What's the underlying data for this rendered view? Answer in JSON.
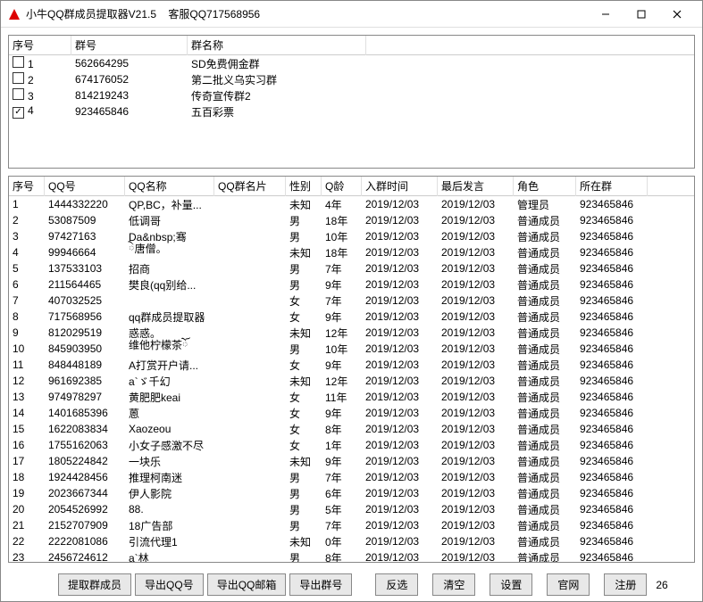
{
  "title": "小牛QQ群成员提取器V21.5    客服QQ717568956",
  "topGrid": {
    "headers": [
      "序号",
      "群号",
      "群名称"
    ],
    "rows": [
      {
        "checked": false,
        "idx": "1",
        "gid": "562664295",
        "gname": "SD免费佣金群"
      },
      {
        "checked": false,
        "idx": "2",
        "gid": "674176052",
        "gname": "第二批义乌实习群"
      },
      {
        "checked": false,
        "idx": "3",
        "gid": "814219243",
        "gname": "传奇宣传群2"
      },
      {
        "checked": true,
        "idx": "4",
        "gid": "923465846",
        "gname": "五百彩票"
      }
    ]
  },
  "bottomGrid": {
    "headers": [
      "序号",
      "QQ号",
      "QQ名称",
      "QQ群名片",
      "性别",
      "Q龄",
      "入群时间",
      "最后发言",
      "角色",
      "所在群"
    ],
    "rows": [
      {
        "c": [
          "1",
          "1444332220",
          "QP,BC，补量...",
          "",
          "未知",
          "4年",
          "2019/12/03",
          "2019/12/03",
          "管理员",
          "923465846"
        ]
      },
      {
        "c": [
          "2",
          "53087509",
          "低调哥",
          "",
          "男",
          "18年",
          "2019/12/03",
          "2019/12/03",
          "普通成员",
          "923465846"
        ]
      },
      {
        "c": [
          "3",
          "97427163",
          "Da&nbsp;骞",
          "",
          "男",
          "10年",
          "2019/12/03",
          "2019/12/03",
          "普通成员",
          "923465846"
        ]
      },
      {
        "c": [
          "4",
          "99946664",
          "ེ唐僧。",
          "",
          "未知",
          "18年",
          "2019/12/03",
          "2019/12/03",
          "普通成员",
          "923465846"
        ]
      },
      {
        "c": [
          "5",
          "137533103",
          "招商",
          "",
          "男",
          "7年",
          "2019/12/03",
          "2019/12/03",
          "普通成员",
          "923465846"
        ]
      },
      {
        "c": [
          "6",
          "211564465",
          "樊良(qq别给...",
          "",
          "男",
          "9年",
          "2019/12/03",
          "2019/12/03",
          "普通成员",
          "923465846"
        ]
      },
      {
        "c": [
          "7",
          "407032525",
          "",
          "",
          "女",
          "7年",
          "2019/12/03",
          "2019/12/03",
          "普通成员",
          "923465846"
        ]
      },
      {
        "c": [
          "8",
          "717568956",
          "qq群成员提取器",
          "",
          "女",
          "9年",
          "2019/12/03",
          "2019/12/03",
          "普通成员",
          "923465846"
        ]
      },
      {
        "c": [
          "9",
          "812029519",
          "惑惑。",
          "",
          "未知",
          "12年",
          "2019/12/03",
          "2019/12/03",
          "普通成员",
          "923465846"
        ]
      },
      {
        "c": [
          "10",
          "845903950",
          "维他柠檬茶ོ",
          "",
          "男",
          "10年",
          "2019/12/03",
          "2019/12/03",
          "普通成员",
          "923465846"
        ]
      },
      {
        "c": [
          "11",
          "848448189",
          "A打赏开户请...",
          "",
          "女",
          "9年",
          "2019/12/03",
          "2019/12/03",
          "普通成员",
          "923465846"
        ]
      },
      {
        "c": [
          "12",
          "961692385",
          "a`ゞ千幻",
          "",
          "未知",
          "12年",
          "2019/12/03",
          "2019/12/03",
          "普通成员",
          "923465846"
        ]
      },
      {
        "c": [
          "13",
          "974978297",
          "黄肥肥keai",
          "",
          "女",
          "11年",
          "2019/12/03",
          "2019/12/03",
          "普通成员",
          "923465846"
        ]
      },
      {
        "c": [
          "14",
          "1401685396",
          "蒽",
          "",
          "女",
          "9年",
          "2019/12/03",
          "2019/12/03",
          "普通成员",
          "923465846"
        ]
      },
      {
        "c": [
          "15",
          "1622083834",
          "Xaozeou",
          "",
          "女",
          "8年",
          "2019/12/03",
          "2019/12/03",
          "普通成员",
          "923465846"
        ]
      },
      {
        "c": [
          "16",
          "1755162063",
          "小女子感激不尽",
          "",
          "女",
          "1年",
          "2019/12/03",
          "2019/12/03",
          "普通成员",
          "923465846"
        ]
      },
      {
        "c": [
          "17",
          "1805224842",
          "一块乐",
          "",
          "未知",
          "9年",
          "2019/12/03",
          "2019/12/03",
          "普通成员",
          "923465846"
        ]
      },
      {
        "c": [
          "18",
          "1924428456",
          "推理柯南迷",
          "",
          "男",
          "7年",
          "2019/12/03",
          "2019/12/03",
          "普通成员",
          "923465846"
        ]
      },
      {
        "c": [
          "19",
          "2023667344",
          "伊人影院",
          "",
          "男",
          "6年",
          "2019/12/03",
          "2019/12/03",
          "普通成员",
          "923465846"
        ]
      },
      {
        "c": [
          "20",
          "2054526992",
          "88.",
          "",
          "男",
          "5年",
          "2019/12/03",
          "2019/12/03",
          "普通成员",
          "923465846"
        ]
      },
      {
        "c": [
          "21",
          "2152707909",
          "18广告部",
          "",
          "男",
          "7年",
          "2019/12/03",
          "2019/12/03",
          "普通成员",
          "923465846"
        ]
      },
      {
        "c": [
          "22",
          "2222081086",
          "引流代理1",
          "",
          "未知",
          "0年",
          "2019/12/03",
          "2019/12/03",
          "普通成员",
          "923465846"
        ]
      },
      {
        "c": [
          "23",
          "2456724612",
          "a`林",
          "",
          "男",
          "8年",
          "2019/12/03",
          "2019/12/03",
          "普通成员",
          "923465846"
        ]
      }
    ]
  },
  "toolbar": {
    "extract_members": "提取群成员",
    "export_qq": "导出QQ号",
    "export_email": "导出QQ邮箱",
    "export_group": "导出群号",
    "invert": "反选",
    "clear": "清空",
    "settings": "设置",
    "website": "官网",
    "register": "注册",
    "count": "26"
  }
}
